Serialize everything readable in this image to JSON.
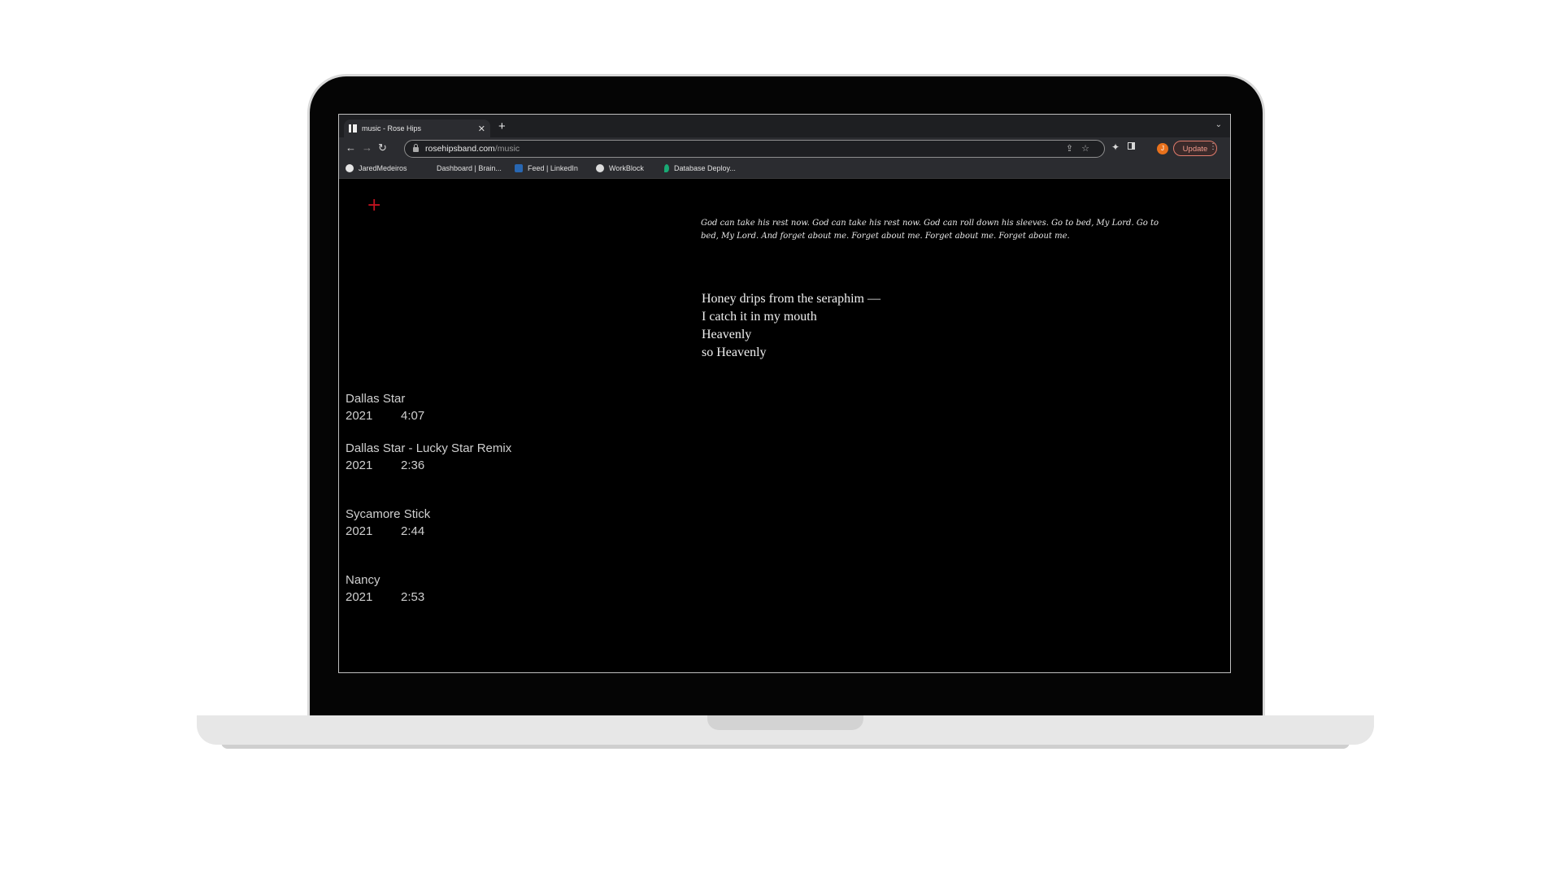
{
  "browser": {
    "tab_title": "music - Rose Hips",
    "new_tab_symbol": "+",
    "url_host": "rosehipsband.com",
    "url_path": "/music",
    "update_label": "Update",
    "profile_initial": "J",
    "bookmarks": [
      {
        "label": "JaredMedeiros",
        "icon": "github-icon"
      },
      {
        "label": "Dashboard | Brain...",
        "icon": "none"
      },
      {
        "label": "Feed | LinkedIn",
        "icon": "linkedin-icon"
      },
      {
        "label": "WorkBlock",
        "icon": "globe-icon"
      },
      {
        "label": "Database Deploy...",
        "icon": "leaf-icon"
      }
    ]
  },
  "page": {
    "plus_symbol": "+",
    "script_text": "God can take his rest now. God can take his rest now. God can roll down his sleeves. Go to bed, My Lord. Go to bed, My Lord. And forget about me. Forget about me. Forget about me. Forget about me.",
    "poem": [
      "Honey drips from the seraphim —",
      "I catch it in my mouth",
      "Heavenly",
      "so Heavenly"
    ],
    "tracks": [
      {
        "name": "Dallas Star",
        "year": "2021",
        "duration": "4:07"
      },
      {
        "name": "Dallas Star - Lucky Star Remix",
        "year": "2021",
        "duration": "2:36"
      },
      {
        "name": "Sycamore Stick",
        "year": "2021",
        "duration": "2:44"
      },
      {
        "name": "Nancy",
        "year": "2021",
        "duration": "2:53"
      }
    ]
  },
  "colors": {
    "accent_plus": "#c1121f",
    "profile": "#e8711c",
    "update": "#f19a8c"
  }
}
